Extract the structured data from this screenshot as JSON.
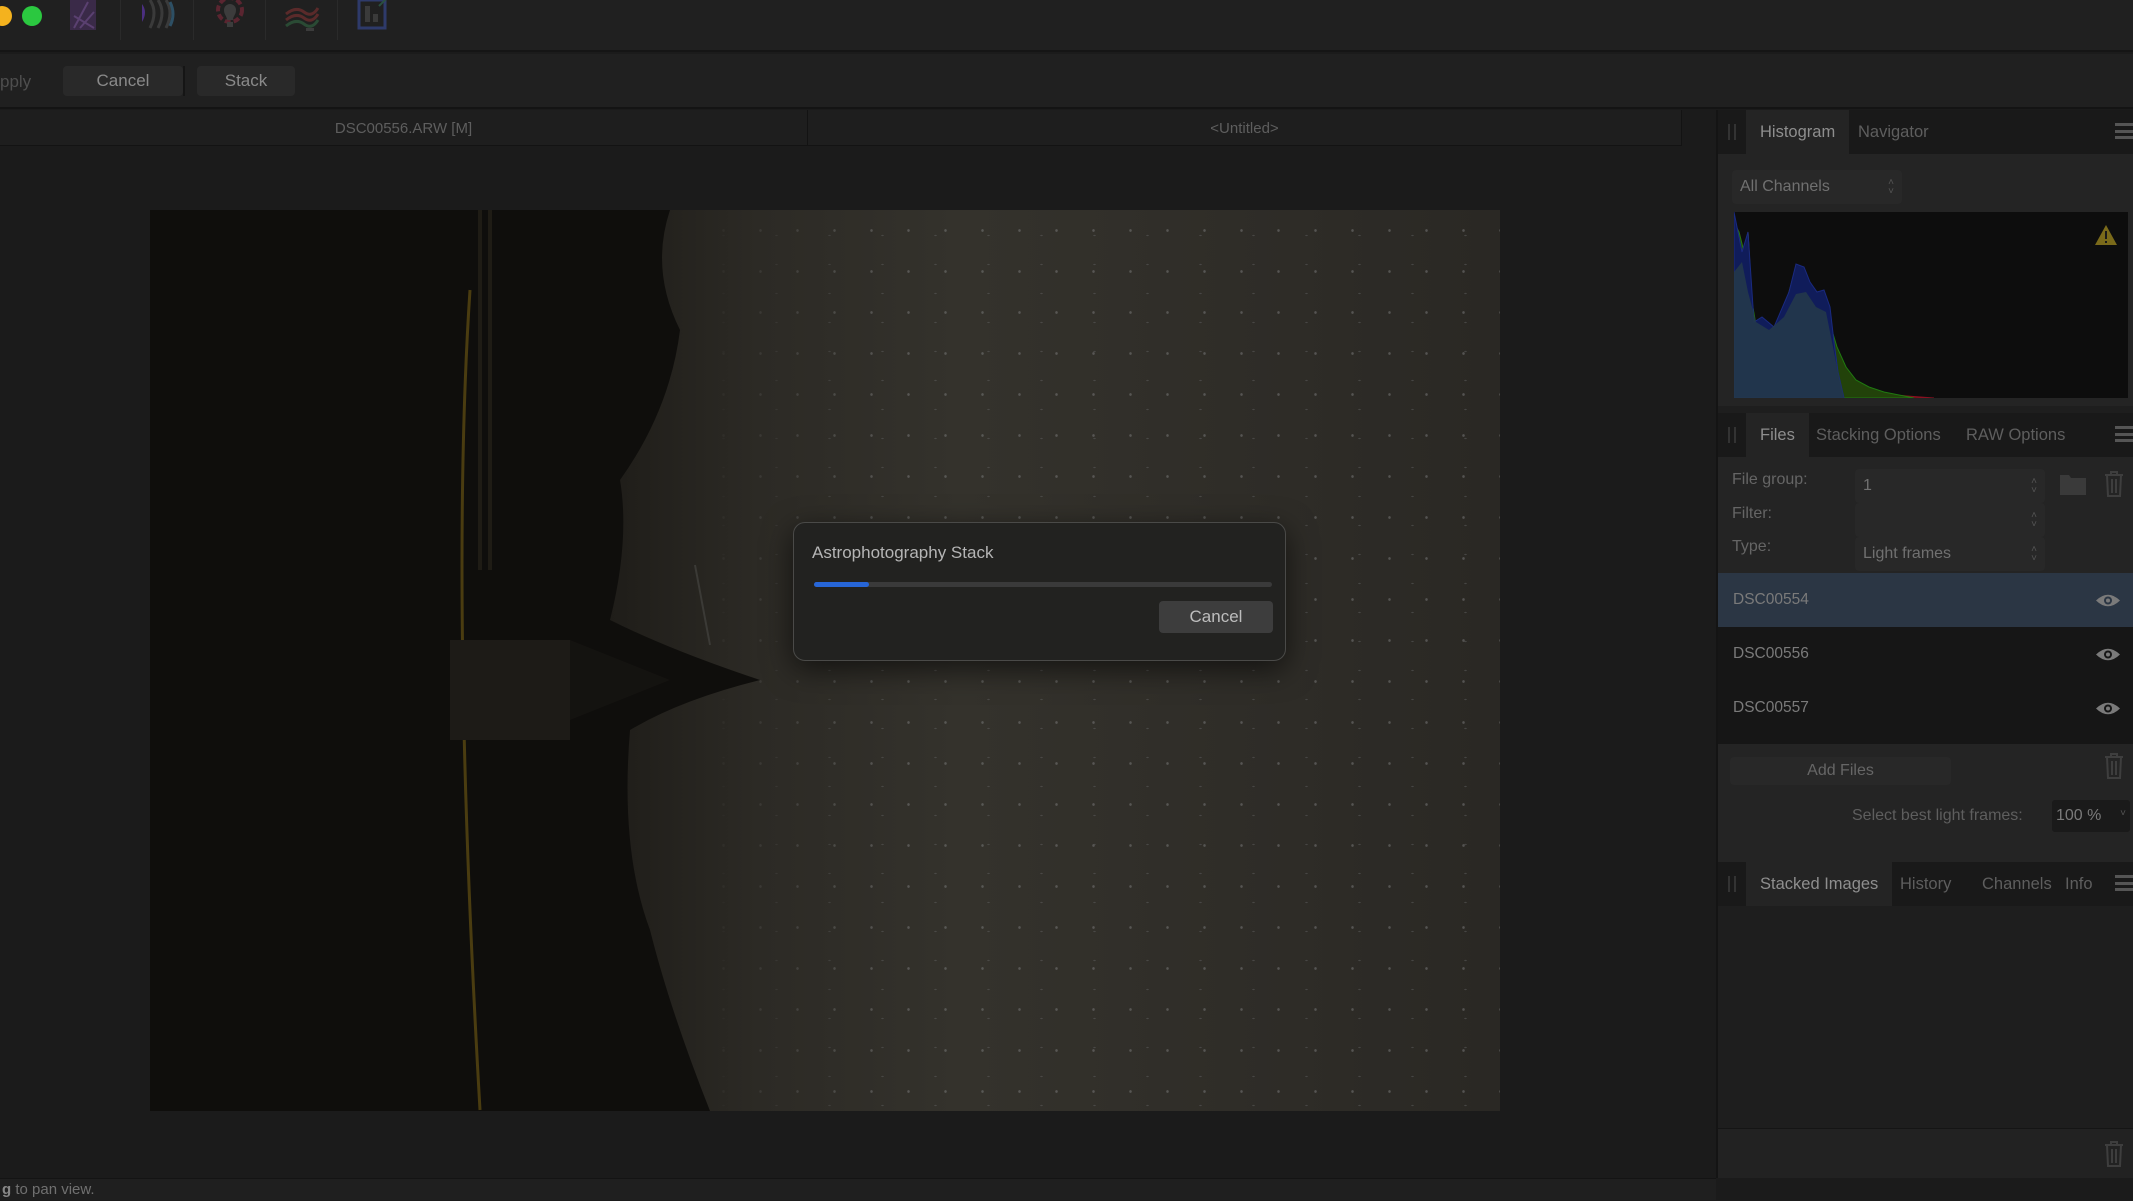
{
  "titlebar": {
    "window_controls": [
      {
        "name": "minimize",
        "color": "#f4b21e"
      },
      {
        "name": "maximize",
        "color": "#2bc840"
      }
    ],
    "persona_icons": [
      "photo-persona-icon",
      "liquify-persona-icon",
      "develop-persona-icon",
      "tone-mapping-persona-icon",
      "export-persona-icon"
    ]
  },
  "toolbar": {
    "apply_label": "pply",
    "cancel_label": "Cancel",
    "stack_label": "Stack"
  },
  "document_tabs": [
    {
      "label": "DSC00556.ARW [M]"
    },
    {
      "label": "<Untitled>"
    }
  ],
  "dialog": {
    "title": "Astrophotography Stack",
    "progress_percent": 12,
    "progress_color": "#2766d8",
    "cancel_label": "Cancel"
  },
  "histogram_panel": {
    "tabs": [
      {
        "label": "Histogram",
        "active": true
      },
      {
        "label": "Navigator",
        "active": false
      }
    ],
    "channel_select": "All Channels",
    "warning_icon": "warning-triangle-icon"
  },
  "files_panel": {
    "tabs": [
      {
        "label": "Files",
        "active": true
      },
      {
        "label": "Stacking Options",
        "active": false
      },
      {
        "label": "RAW Options",
        "active": false
      }
    ],
    "file_group_label": "File group:",
    "file_group_value": "1",
    "filter_label": "Filter:",
    "filter_value": "",
    "type_label": "Type:",
    "type_value": "Light frames",
    "files": [
      {
        "name": "DSC00554",
        "selected": true
      },
      {
        "name": "DSC00556",
        "selected": false
      },
      {
        "name": "DSC00557",
        "selected": false
      }
    ],
    "add_files_label": "Add Files",
    "select_best_label": "Select best light frames:",
    "select_best_value": "100 %"
  },
  "stacked_panel": {
    "tabs": [
      {
        "label": "Stacked Images",
        "active": true
      },
      {
        "label": "History",
        "active": false
      },
      {
        "label": "Channels",
        "active": false
      },
      {
        "label": "Info",
        "active": false
      }
    ]
  },
  "statusbar": {
    "hint_key": "g",
    "hint_text": " to pan view."
  }
}
